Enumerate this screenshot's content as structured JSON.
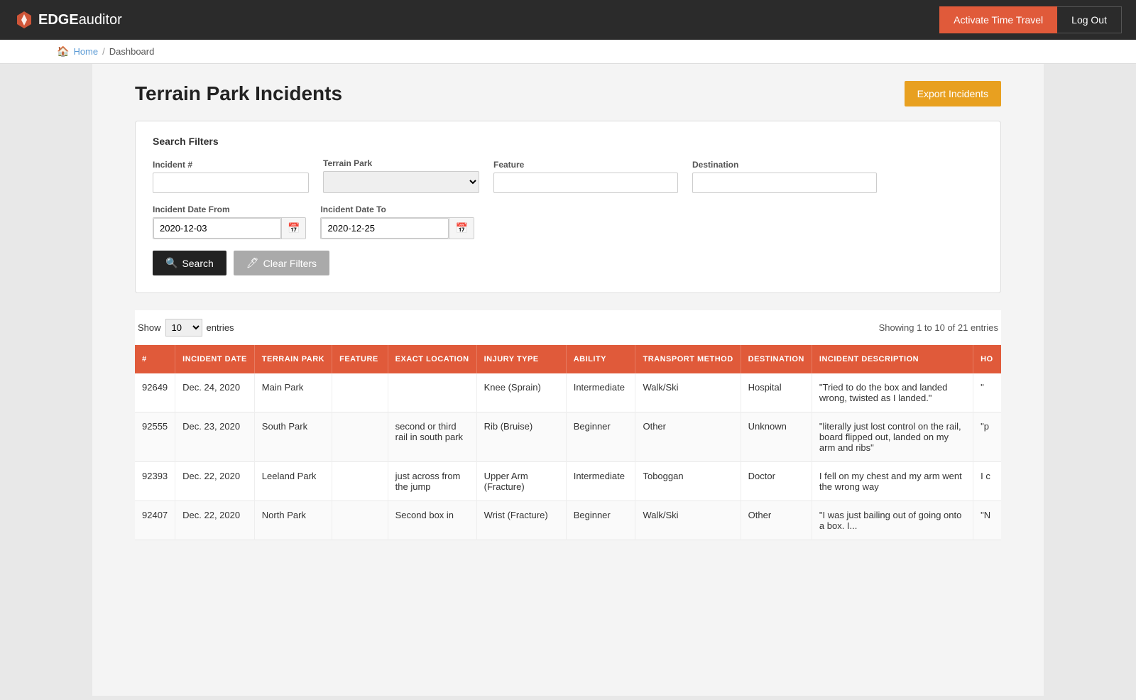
{
  "navbar": {
    "brand": "EDGEauditor",
    "brand_edge": "EDGE",
    "brand_rest": "auditor",
    "btn_time_travel": "Activate Time Travel",
    "btn_logout": "Log Out"
  },
  "breadcrumb": {
    "home": "Home",
    "separator": "/",
    "current": "Dashboard"
  },
  "page": {
    "title": "Terrain Park Incidents",
    "export_btn": "Export Incidents"
  },
  "filters": {
    "title": "Search Filters",
    "incident_label": "Incident #",
    "incident_placeholder": "",
    "terrain_label": "Terrain Park",
    "terrain_placeholder": "",
    "feature_label": "Feature",
    "feature_placeholder": "",
    "destination_label": "Destination",
    "destination_placeholder": "",
    "date_from_label": "Incident Date From",
    "date_from_value": "2020-12-03",
    "date_to_label": "Incident Date To",
    "date_to_value": "2020-12-25",
    "search_btn": "Search",
    "clear_btn": "Clear Filters"
  },
  "table_controls": {
    "show_label": "Show",
    "show_value": "10",
    "entries_label": "entries",
    "showing_info": "Showing 1 to 10 of 21 entries"
  },
  "table_headers": [
    "#",
    "INCIDENT DATE",
    "TERRAIN PARK",
    "FEATURE",
    "EXACT LOCATION",
    "INJURY TYPE",
    "ABILITY",
    "TRANSPORT METHOD",
    "DESTINATION",
    "INCIDENT DESCRIPTION",
    "HO"
  ],
  "table_rows": [
    {
      "num": "92649",
      "date": "Dec. 24, 2020",
      "park": "Main Park",
      "feature": "",
      "location": "",
      "injury": "Knee (Sprain)",
      "ability": "Intermediate",
      "transport": "Walk/Ski",
      "destination": "Hospital",
      "description": "\"Tried to do the box and landed wrong, twisted as I landed.\"",
      "ho": "\""
    },
    {
      "num": "92555",
      "date": "Dec. 23, 2020",
      "park": "South Park",
      "feature": "",
      "location": "second or third rail in south park",
      "injury": "Rib (Bruise)",
      "ability": "Beginner",
      "transport": "Other",
      "destination": "Unknown",
      "description": "\"literally just lost control on the rail, board flipped out, landed on my arm and ribs\"",
      "ho": "\"p"
    },
    {
      "num": "92393",
      "date": "Dec. 22, 2020",
      "park": "Leeland Park",
      "feature": "",
      "location": "just across from the jump",
      "injury": "Upper Arm (Fracture)",
      "ability": "Intermediate",
      "transport": "Toboggan",
      "destination": "Doctor",
      "description": "I fell on my chest and my arm went the wrong way",
      "ho": "I c"
    },
    {
      "num": "92407",
      "date": "Dec. 22, 2020",
      "park": "North Park",
      "feature": "",
      "location": "Second box in",
      "injury": "Wrist (Fracture)",
      "ability": "Beginner",
      "transport": "Walk/Ski",
      "destination": "Other",
      "description": "\"I was just bailing out of going onto a box. I...",
      "ho": "\"N"
    }
  ]
}
